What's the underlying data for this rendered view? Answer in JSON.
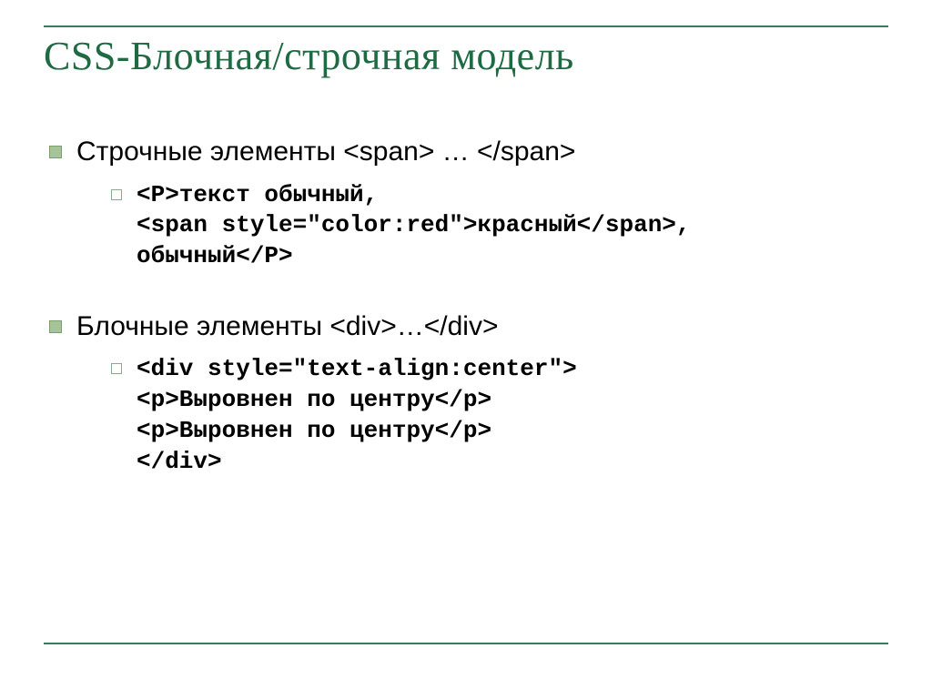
{
  "title": "CSS-Блочная/строчная модель",
  "items": [
    {
      "label": "Строчные элементы <span> … </span>",
      "sub": "<P>текст обычный,\n<span style=\"color:red\">красный</span>,\nобычный</P>"
    },
    {
      "label": "Блочные элементы <div>…</div>",
      "sub": "<div style=\"text-align:center\">\n<p>Выровнен по центру</p>\n<p>Выровнен по центру</p>\n</div>"
    }
  ]
}
